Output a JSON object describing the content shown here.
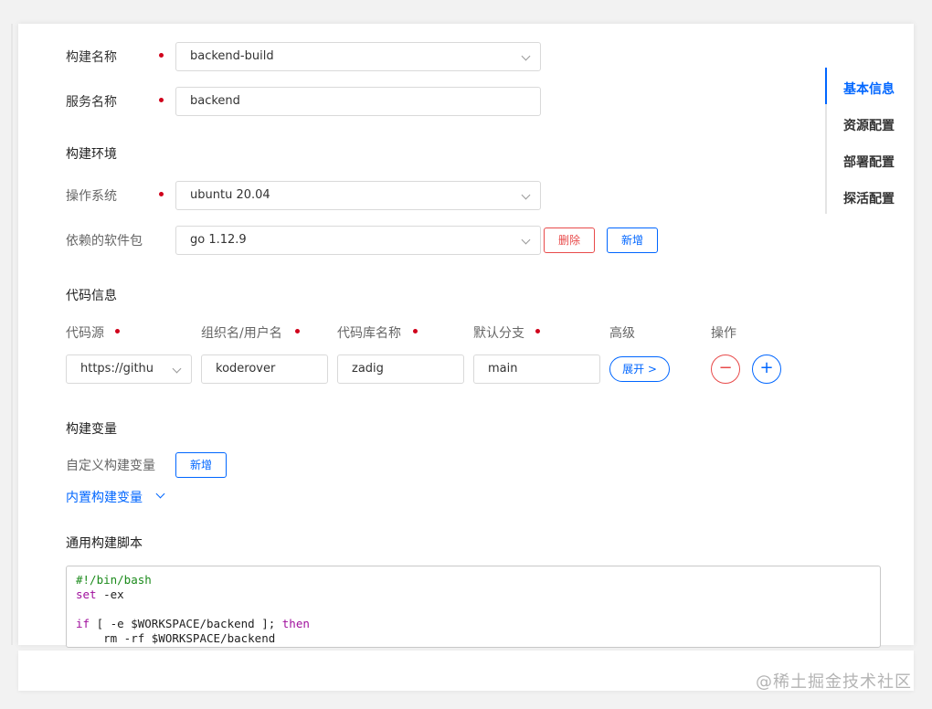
{
  "form": {
    "build_name": {
      "label": "构建名称",
      "value": "backend-build"
    },
    "service_name": {
      "label": "服务名称",
      "value": "backend"
    },
    "env_section": "构建环境",
    "os": {
      "label": "操作系统",
      "value": "ubuntu 20.04"
    },
    "packages": {
      "label": "依赖的软件包",
      "value": "go 1.12.9",
      "delete_label": "删除",
      "add_label": "新增"
    }
  },
  "code_info": {
    "section": "代码信息",
    "headers": [
      "代码源",
      "组织名/用户名",
      "代码库名称",
      "默认分支",
      "高级",
      "操作"
    ],
    "row": {
      "source": "https://githu",
      "org": "koderover",
      "repo": "zadig",
      "branch": "main",
      "expand_label": "展开 >"
    },
    "remove_symbol": "−",
    "add_symbol": "+"
  },
  "build_vars": {
    "section": "构建变量",
    "custom_label": "自定义构建变量",
    "add_label": "新增",
    "builtin_link": "内置构建变量"
  },
  "script": {
    "section": "通用构建脚本",
    "line1": "#!/bin/bash",
    "line2_kw": "set",
    "line2_rest": " -ex",
    "line4_kw1": "if",
    "line4_mid": " [ -e $WORKSPACE/backend ]; ",
    "line4_kw2": "then",
    "line5": "    rm -rf $WORKSPACE/backend"
  },
  "side_nav": {
    "items": [
      "基本信息",
      "资源配置",
      "部署配置",
      "探活配置"
    ],
    "active_index": 0
  },
  "watermark": "@稀土掘金技术社区",
  "colors": {
    "accent": "#0066ff",
    "danger": "#e84a4a",
    "required": "#d0021b"
  }
}
